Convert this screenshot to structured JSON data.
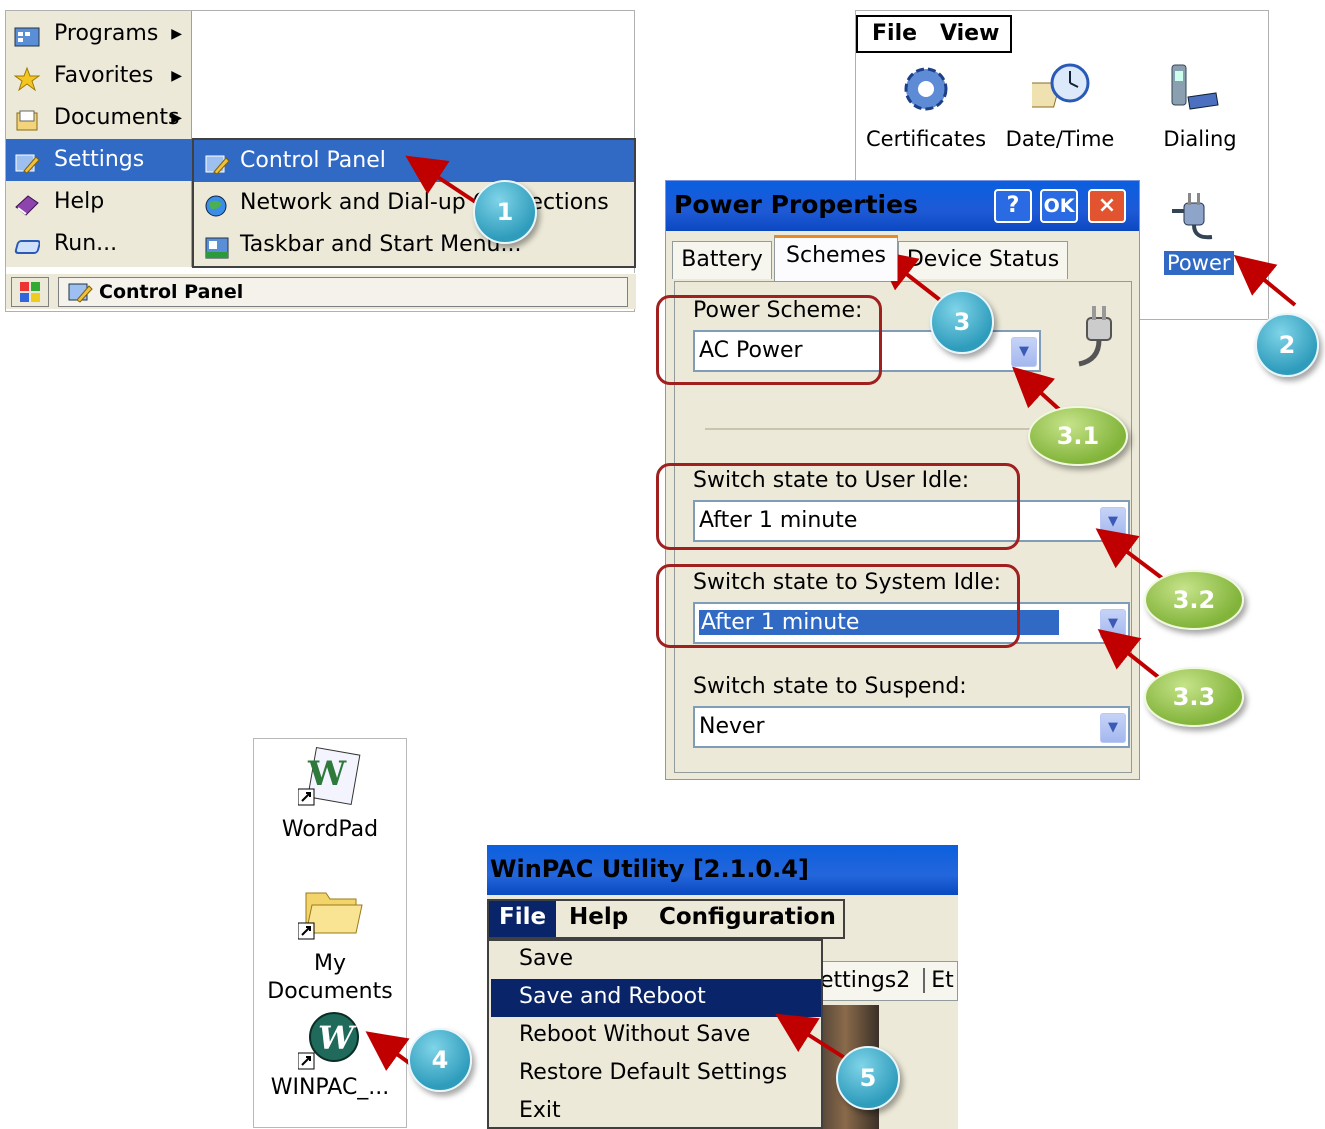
{
  "start_menu": {
    "items": [
      {
        "label": "Programs",
        "icon": "programs-icon",
        "has_submenu": true
      },
      {
        "label": "Favorites",
        "icon": "favorites-star-icon",
        "has_submenu": true
      },
      {
        "label": "Documents",
        "icon": "documents-icon",
        "has_submenu": true
      },
      {
        "label": "Settings",
        "icon": "settings-icon",
        "has_submenu": true,
        "selected": true
      },
      {
        "label": "Help",
        "icon": "help-book-icon",
        "has_submenu": false
      },
      {
        "label": "Run...",
        "icon": "run-icon",
        "has_submenu": false
      }
    ],
    "submenu": [
      {
        "label": "Control Panel",
        "icon": "control-panel-icon",
        "selected": true
      },
      {
        "label": "Network and Dial-up Connections",
        "icon": "network-globe-icon"
      },
      {
        "label": "Taskbar and Start Menu...",
        "icon": "taskbar-icon"
      }
    ],
    "taskbar": {
      "active_task": "Control Panel"
    }
  },
  "control_panel": {
    "menu": [
      "File",
      "View"
    ],
    "icons": [
      {
        "label": "Certificates",
        "icon": "certificates-gear-icon"
      },
      {
        "label": "Date/Time",
        "icon": "date-time-clock-icon"
      },
      {
        "label": "Dialing",
        "icon": "dialing-phone-icon"
      },
      {
        "label": "Power",
        "icon": "power-plug-icon",
        "selected": true
      }
    ]
  },
  "power_dialog": {
    "title": "Power Properties",
    "buttons": {
      "help": "?",
      "ok": "OK",
      "close": "×"
    },
    "tabs": [
      "Battery",
      "Schemes",
      "Device Status"
    ],
    "active_tab": "Schemes",
    "power_scheme": {
      "label": "Power Scheme:",
      "value": "AC Power"
    },
    "user_idle": {
      "label": "Switch state to User Idle:",
      "value": "After 1 minute"
    },
    "system_idle": {
      "label": "Switch state to System Idle:",
      "value": "After 1 minute"
    },
    "suspend": {
      "label": "Switch state to Suspend:",
      "value": "Never"
    }
  },
  "desktop": {
    "icons": [
      {
        "label": "WordPad",
        "icon": "wordpad-icon"
      },
      {
        "label_line1": "My",
        "label_line2": "Documents",
        "icon": "folder-icon"
      },
      {
        "label": "WINPAC_...",
        "icon": "winpac-w-icon"
      }
    ]
  },
  "winpac": {
    "title": "WinPAC Utility [2.1.0.4]",
    "menu": [
      "File",
      "Help",
      "Configuration"
    ],
    "partial_tabs": [
      "ettings2",
      "Et"
    ],
    "file_menu": [
      {
        "label": "Save"
      },
      {
        "label": "Save and Reboot",
        "selected": true
      },
      {
        "label": "Reboot Without Save"
      },
      {
        "label": "Restore Default Settings"
      },
      {
        "label": "Exit"
      }
    ]
  },
  "callouts": [
    "1",
    "2",
    "3",
    "3.1",
    "3.2",
    "3.3",
    "4",
    "5"
  ],
  "colors": {
    "selection": "#316ac5",
    "menu_selection_dark": "#0a246a",
    "titlebar": "#1e5ad6",
    "callout_blue": "#2f9cbc",
    "callout_green": "#82b43a",
    "arrow_red": "#c00000"
  }
}
